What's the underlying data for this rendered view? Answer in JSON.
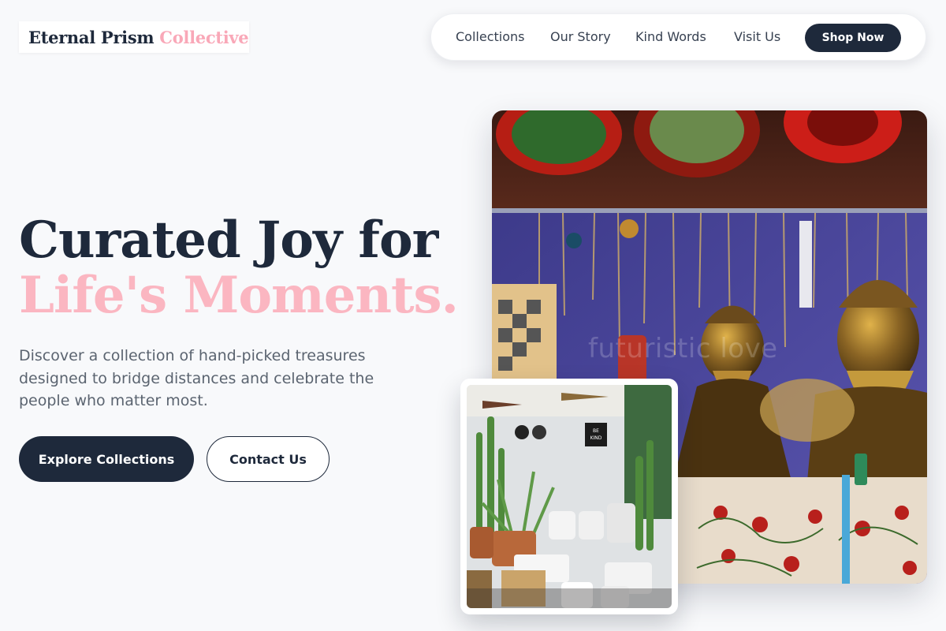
{
  "brand": {
    "name_primary": "Eternal Prism",
    "name_accent": "Collective"
  },
  "nav": {
    "links": [
      "Collections",
      "Our Story",
      "Kind Words",
      "Visit Us"
    ],
    "cta_label": "Shop Now"
  },
  "hero": {
    "title_line1": "Curated Joy for",
    "title_line2": "Life's Moments.",
    "description": "Discover a collection of hand-picked treasures designed to bridge distances and celebrate the people who matter most.",
    "primary_button": "Explore Collections",
    "secondary_button": "Contact Us"
  },
  "images": {
    "main_watermark": "futuristic love",
    "small_sign_text": "BE KIND"
  },
  "colors": {
    "navy": "#1e293b",
    "pink": "#fbb6c1",
    "background": "#f8f9fb"
  }
}
